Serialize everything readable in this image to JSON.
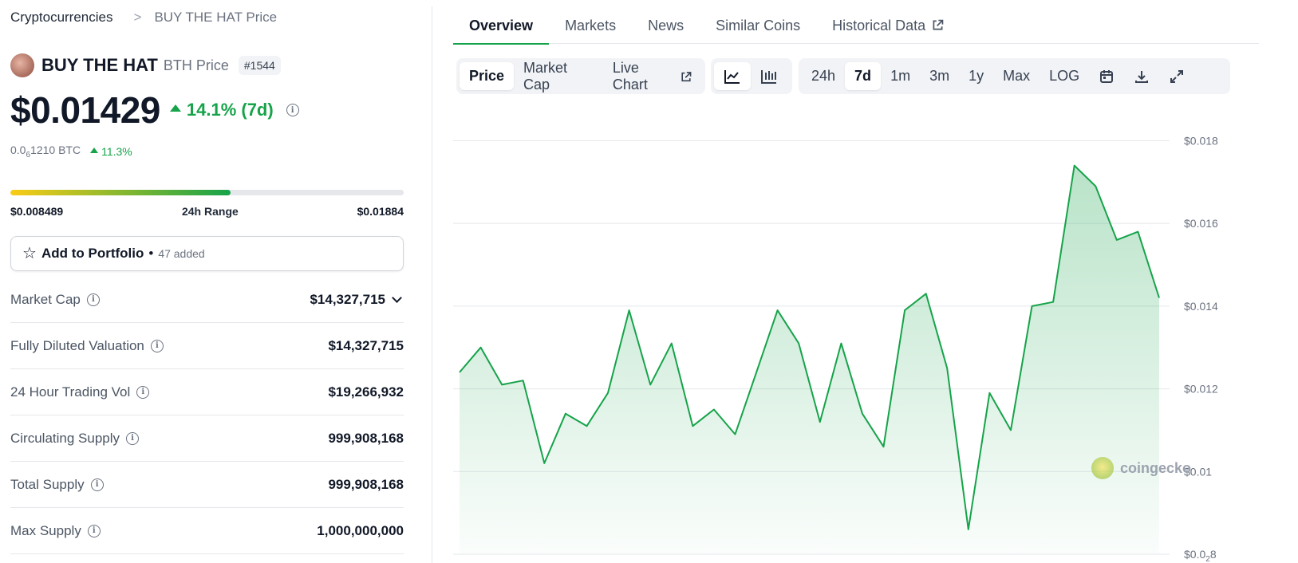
{
  "breadcrumb": {
    "root": "Cryptocurrencies",
    "separator": ">",
    "current": "BUY THE HAT Price"
  },
  "coin": {
    "name": "BUY THE HAT",
    "symbol_label": "BTH Price",
    "rank": "#1544"
  },
  "price": {
    "usd": "$0.01429",
    "change_7d": "14.1% (7d)",
    "btc_prefix": "0.0",
    "btc_sub": "6",
    "btc_rest": "1210 BTC",
    "btc_change": "11.3%"
  },
  "range_24h": {
    "low": "$0.008489",
    "label": "24h Range",
    "high": "$0.01884",
    "position_fraction": 0.56
  },
  "portfolio": {
    "label": "Add to Portfolio",
    "dot": "•",
    "count": "47 added"
  },
  "stats": [
    {
      "label": "Market Cap",
      "value": "$14,327,715",
      "expandable": true
    },
    {
      "label": "Fully Diluted Valuation",
      "value": "$14,327,715"
    },
    {
      "label": "24 Hour Trading Vol",
      "value": "$19,266,932"
    },
    {
      "label": "Circulating Supply",
      "value": "999,908,168"
    },
    {
      "label": "Total Supply",
      "value": "999,908,168"
    },
    {
      "label": "Max Supply",
      "value": "1,000,000,000"
    }
  ],
  "tabs": [
    "Overview",
    "Markets",
    "News",
    "Similar Coins",
    "Historical Data"
  ],
  "chart_controls": {
    "metric": [
      "Price",
      "Market Cap",
      "Live Chart"
    ],
    "ranges": [
      "24h",
      "7d",
      "1m",
      "3m",
      "1y",
      "Max",
      "LOG"
    ],
    "active_range": "7d",
    "active_metric": "Price"
  },
  "watermark": "coingecko",
  "colors": {
    "accent_green": "#16a34a",
    "fill_green": "#86efac",
    "text_muted": "#6b7280"
  },
  "chart_data": {
    "type": "area",
    "title": "",
    "xlabel": "",
    "ylabel": "",
    "ylim": [
      0.008,
      0.0188
    ],
    "y_ticks": [
      {
        "value": 0.018,
        "label": "$0.018"
      },
      {
        "value": 0.016,
        "label": "$0.016"
      },
      {
        "value": 0.014,
        "label": "$0.014"
      },
      {
        "value": 0.012,
        "label": "$0.012"
      },
      {
        "value": 0.01,
        "label": "$0.01"
      },
      {
        "value": 0.008,
        "label_main": "$0.0",
        "label_sub": "2",
        "label_tail": "8"
      }
    ],
    "grid": true,
    "series": [
      {
        "values": [
          0.0124,
          0.013,
          0.0121,
          0.0122,
          0.0102,
          0.0114,
          0.0111,
          0.0119,
          0.0139,
          0.0121,
          0.0131,
          0.0111,
          0.0115,
          0.0109,
          0.0124,
          0.0139,
          0.0131,
          0.0112,
          0.0131,
          0.0114,
          0.0106,
          0.0139,
          0.0143,
          0.0125,
          0.0086,
          0.0119,
          0.011,
          0.014,
          0.0141,
          0.0174,
          0.0169,
          0.0156,
          0.0158,
          0.0142
        ]
      }
    ]
  }
}
